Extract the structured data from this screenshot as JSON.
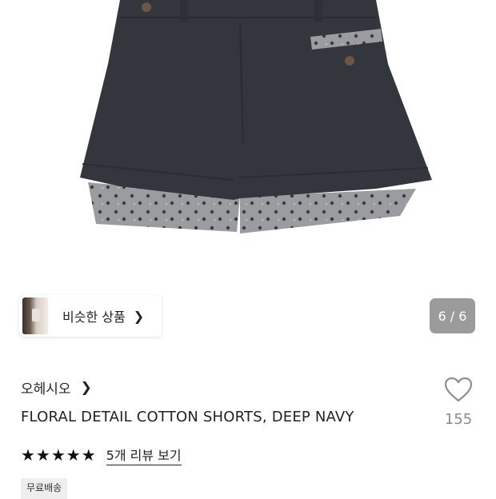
{
  "image": {
    "alt": ""
  },
  "similar": {
    "label": "비슷한 상품",
    "chevron": "chevron-right-icon"
  },
  "gallery": {
    "counter": "6 / 6"
  },
  "product": {
    "brand": "오헤시오",
    "brand_chevron": "chevron-right-icon",
    "name": "FLORAL DETAIL COTTON SHORTS, DEEP NAVY",
    "wish_count": "155",
    "rating_stars": "★★★★★",
    "review_link": "5개 리뷰 보기",
    "shipping_badge": "무료배송"
  },
  "colors": {
    "garment": "#33363d",
    "lining": "#8d8f93",
    "counter_bg": "#9b9b9b"
  }
}
